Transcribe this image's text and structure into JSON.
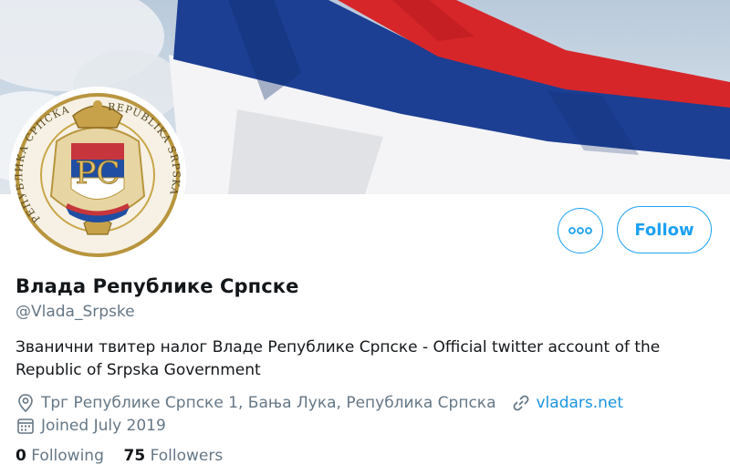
{
  "banner": {
    "description_colors": {
      "red": "#c6363c",
      "blue": "#0c4076",
      "white": "#ffffff"
    }
  },
  "avatar": {
    "emblem_text_left": "РЕПУБЛИКА СРПСКА",
    "emblem_text_right": "REPUBLIKA SRPSKA",
    "monogram": "РС"
  },
  "actions": {
    "follow_label": "Follow",
    "more_icon": "more-dots-icon"
  },
  "profile": {
    "display_name": "Влада Републике Српске",
    "handle": "@Vlada_Srpske",
    "bio": "Званични твитер налог Владе Републике Српске - Official twitter account of the Republic of Srpska Government",
    "location": "Трг Републике Српске 1, Бања Лука, Република Српска",
    "website": "vladars.net",
    "joined": "Joined July 2019"
  },
  "counts": {
    "following_value": "0",
    "following_label": "Following",
    "followers_value": "75",
    "followers_label": "Followers"
  },
  "colors": {
    "accent": "#1da1f2",
    "secondary_text": "#657786",
    "primary_text": "#14171a",
    "link": "#1b95e0"
  }
}
